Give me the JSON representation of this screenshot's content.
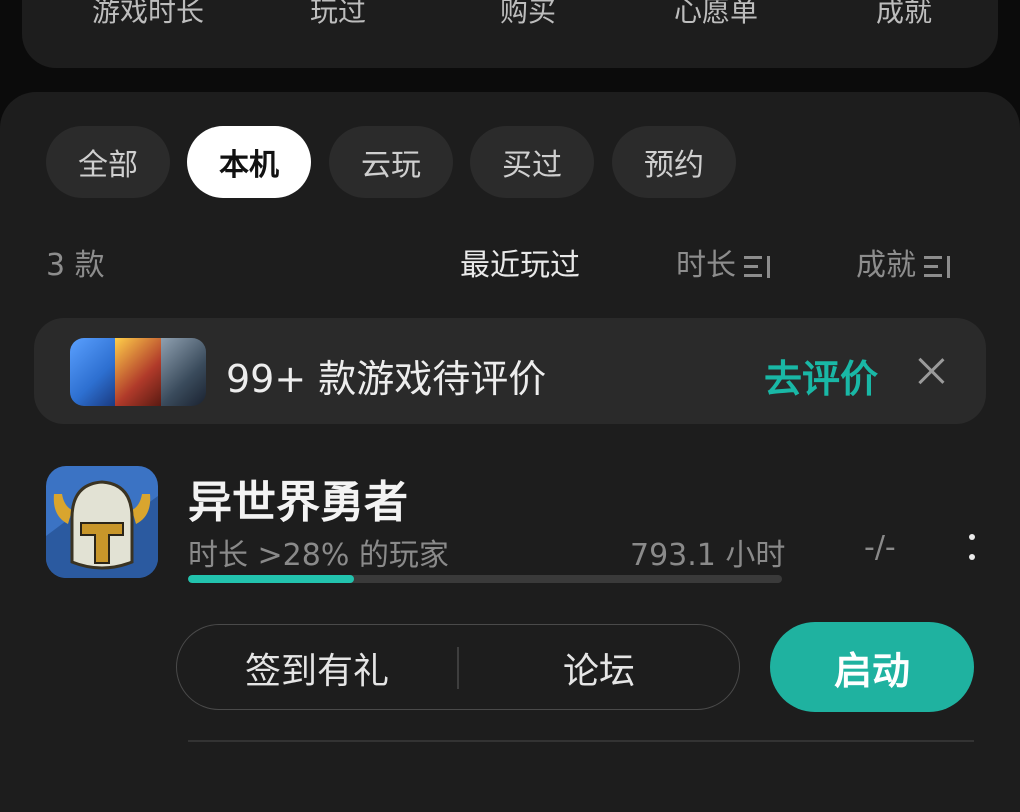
{
  "top_tabs": [
    "游戏时长",
    "玩过",
    "购买",
    "心愿单",
    "成就"
  ],
  "filter_chips": [
    {
      "label": "全部",
      "active": false
    },
    {
      "label": "本机",
      "active": true
    },
    {
      "label": "云玩",
      "active": false
    },
    {
      "label": "买过",
      "active": false
    },
    {
      "label": "预约",
      "active": false
    }
  ],
  "list": {
    "count_label": "3 款",
    "sort": {
      "recent": "最近玩过",
      "duration": "时长",
      "achievement": "成就"
    }
  },
  "review_banner": {
    "text": "99+ 款游戏待评价",
    "cta": "去评价",
    "close_icon": "close-icon",
    "icon_colors": [
      "#2d6fd0",
      "#b03a2a",
      "#3a4b5c"
    ]
  },
  "game": {
    "title": "异世界勇者",
    "stat_text": "时长 >28% 的玩家",
    "hours": "793.1 小时",
    "achievement": "-/-",
    "progress": 0.28,
    "icon": "knight-helmet-icon",
    "actions": {
      "checkin": "签到有礼",
      "forum": "论坛",
      "launch": "启动"
    }
  },
  "colors": {
    "accent": "#1fb2a0",
    "background": "#0b0b0b",
    "card": "#1d1d1d"
  }
}
